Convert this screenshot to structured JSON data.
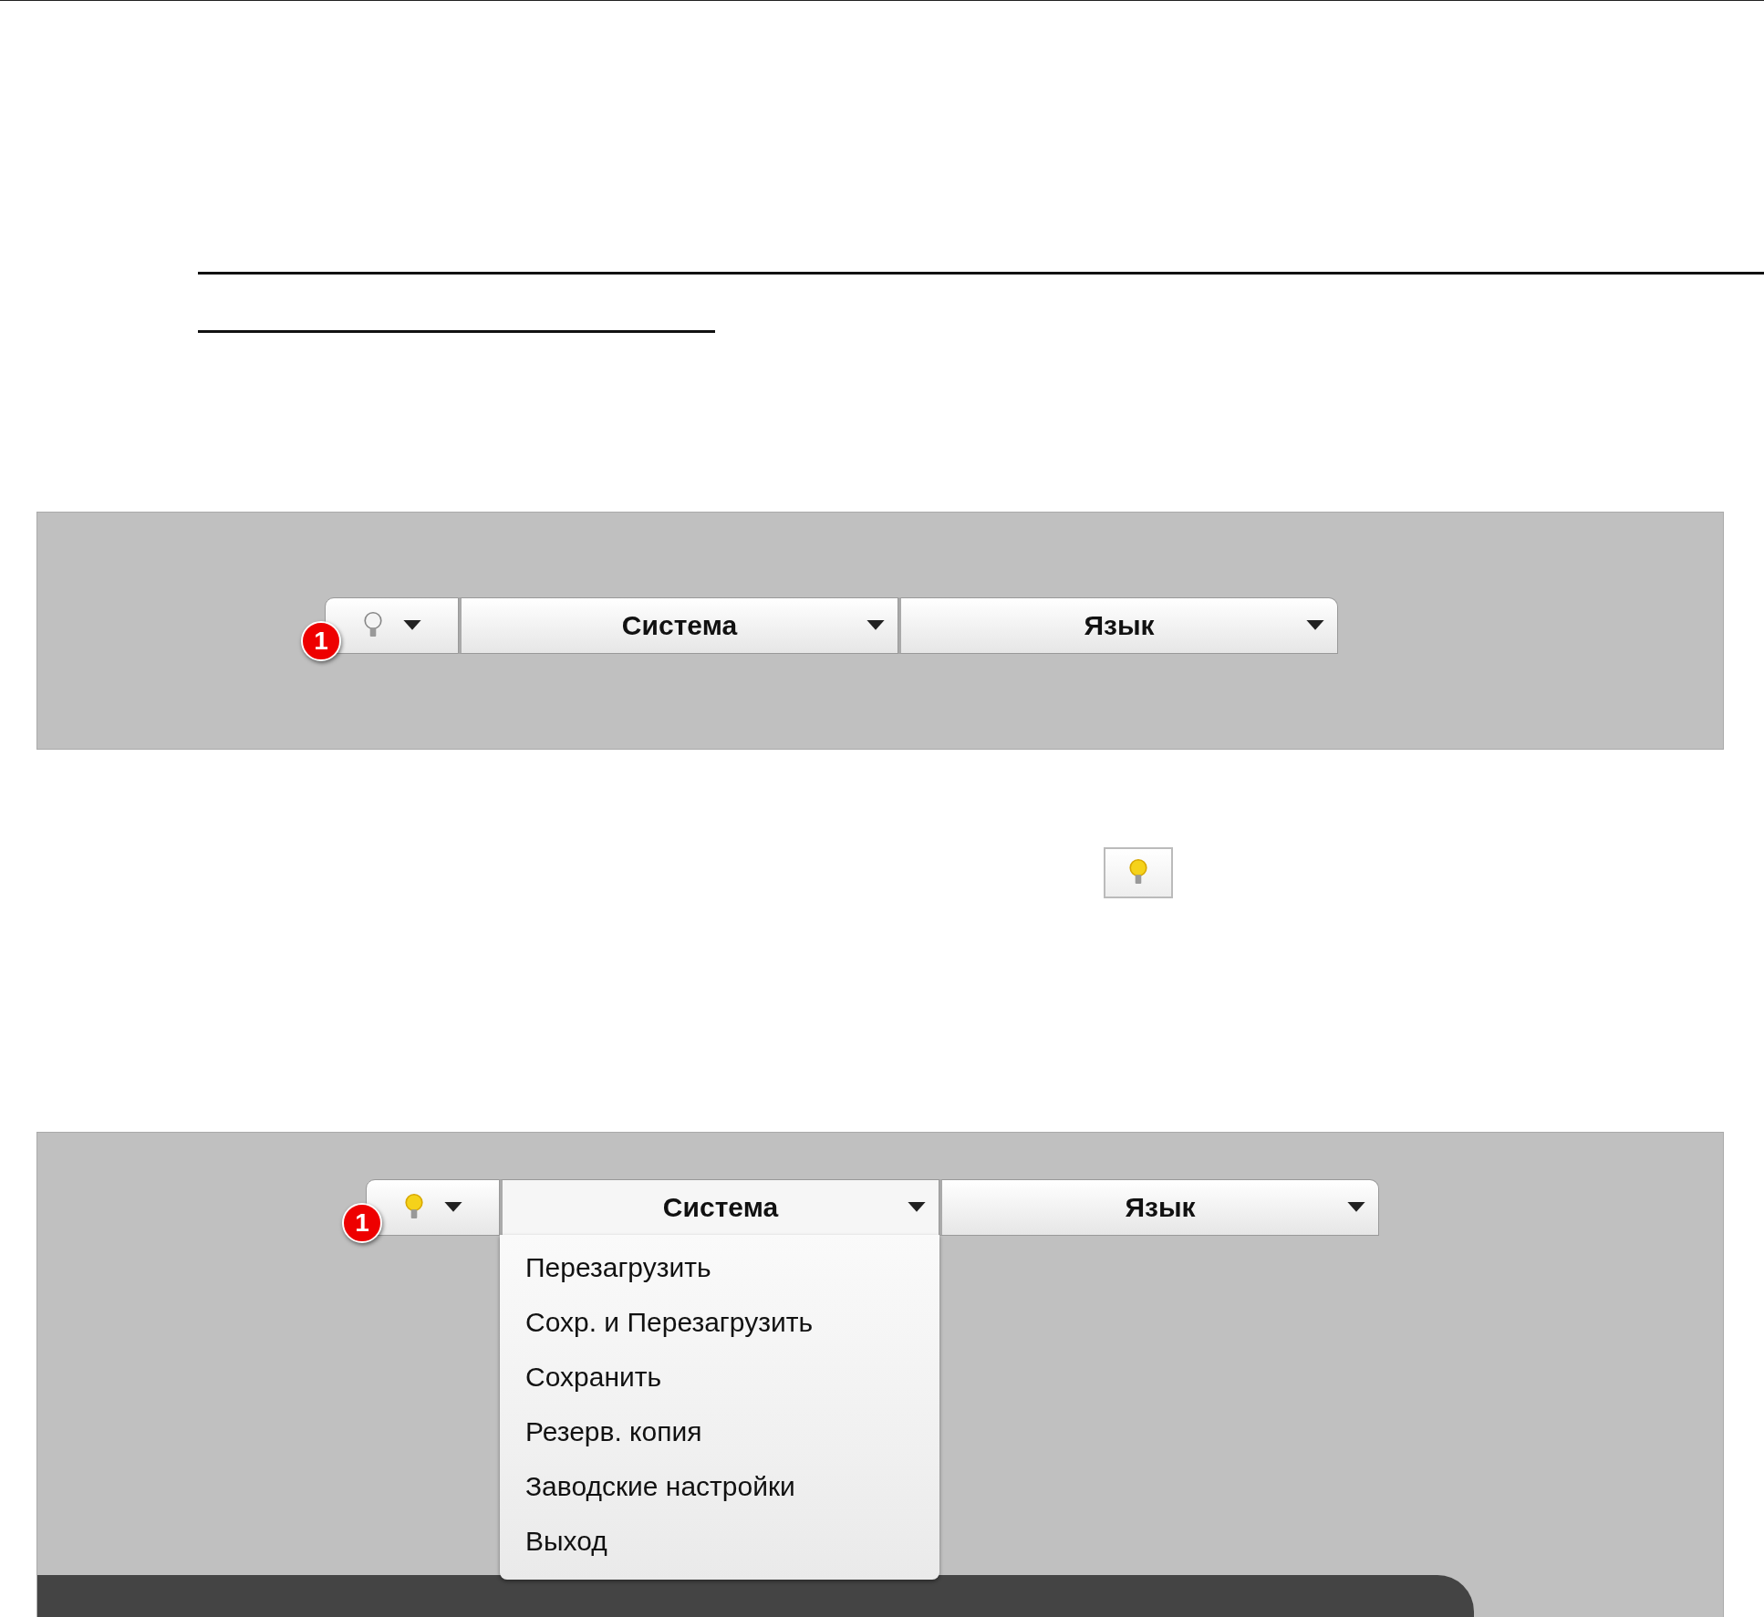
{
  "screenshots": [
    {
      "badge": "1",
      "bulb_lit": false,
      "menus": [
        {
          "label": "Система",
          "expanded": false
        },
        {
          "label": "Язык",
          "expanded": false
        }
      ]
    },
    {
      "badge": "1",
      "bulb_lit": true,
      "menus": [
        {
          "label": "Система",
          "expanded": true,
          "items": [
            "Перезагрузить",
            "Сохр. и Перезагрузить",
            "Сохранить",
            "Резерв. копия",
            "Заводские настройки",
            "Выход"
          ]
        },
        {
          "label": "Язык",
          "expanded": false
        }
      ]
    }
  ],
  "inline_button": {
    "bulb_lit": true
  }
}
